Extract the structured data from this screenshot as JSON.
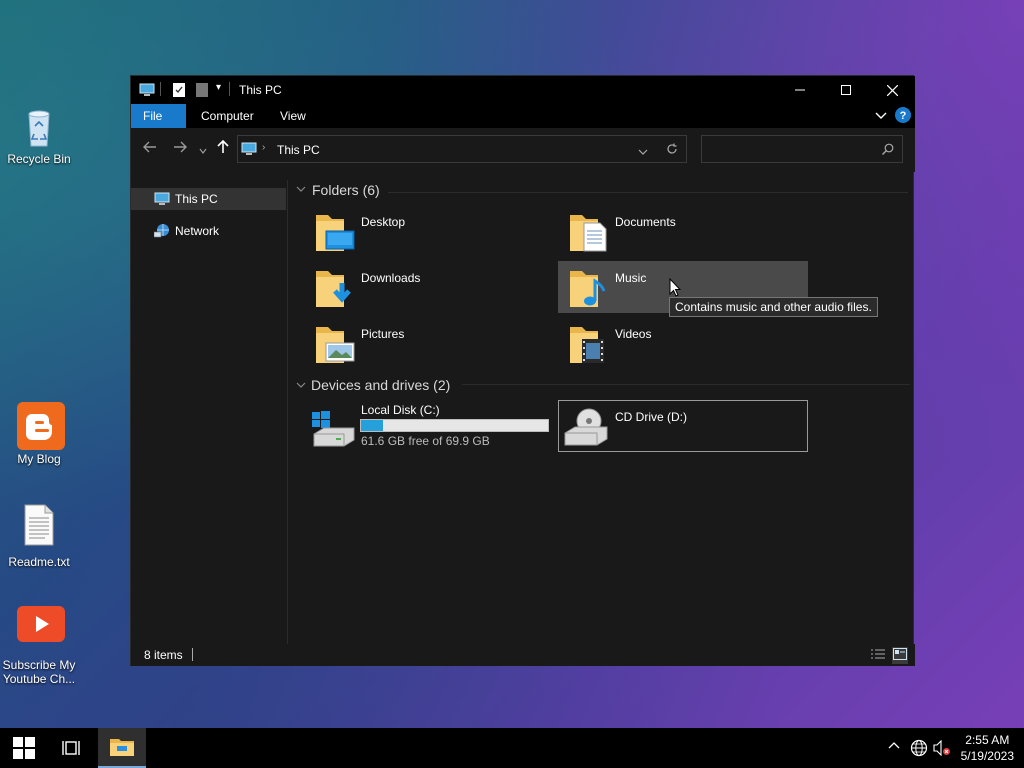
{
  "desktop": {
    "icons": [
      {
        "label": "Recycle Bin",
        "icon": "recycle-bin-icon"
      },
      {
        "label": "My Blog",
        "icon": "blogger-icon"
      },
      {
        "label": "Readme.txt",
        "icon": "text-file-icon"
      },
      {
        "label": "Subscribe My Youtube Ch...",
        "icon": "youtube-icon"
      }
    ]
  },
  "window": {
    "title": "This PC",
    "ribbon_tabs": [
      "File",
      "Computer",
      "View"
    ],
    "address": "This PC",
    "search_placeholder": "",
    "nav": [
      {
        "label": "This PC",
        "icon": "computer-icon",
        "selected": true
      },
      {
        "label": "Network",
        "icon": "network-icon",
        "selected": false
      }
    ],
    "folders_header": "Folders (6)",
    "folders": [
      {
        "name": "Desktop",
        "icon": "desktop-folder-icon"
      },
      {
        "name": "Documents",
        "icon": "documents-folder-icon"
      },
      {
        "name": "Downloads",
        "icon": "downloads-folder-icon"
      },
      {
        "name": "Music",
        "icon": "music-folder-icon",
        "hover": true
      },
      {
        "name": "Pictures",
        "icon": "pictures-folder-icon"
      },
      {
        "name": "Videos",
        "icon": "videos-folder-icon"
      }
    ],
    "drives_header": "Devices and drives (2)",
    "drives": [
      {
        "name": "Local Disk (C:)",
        "icon": "local-disk-icon",
        "free_text": "61.6 GB free of 69.9 GB",
        "used_fraction": 0.119
      },
      {
        "name": "CD Drive (D:)",
        "icon": "cd-drive-icon",
        "selected": true
      }
    ],
    "tooltip": "Contains music and other audio files.",
    "status": "8 items"
  },
  "taskbar": {
    "time": "2:55 AM",
    "date": "5/19/2023"
  },
  "colors": {
    "accent": "#1979ca",
    "window_bg": "#191919",
    "titlebar": "#000000",
    "drive_bar": "#26a0da"
  }
}
